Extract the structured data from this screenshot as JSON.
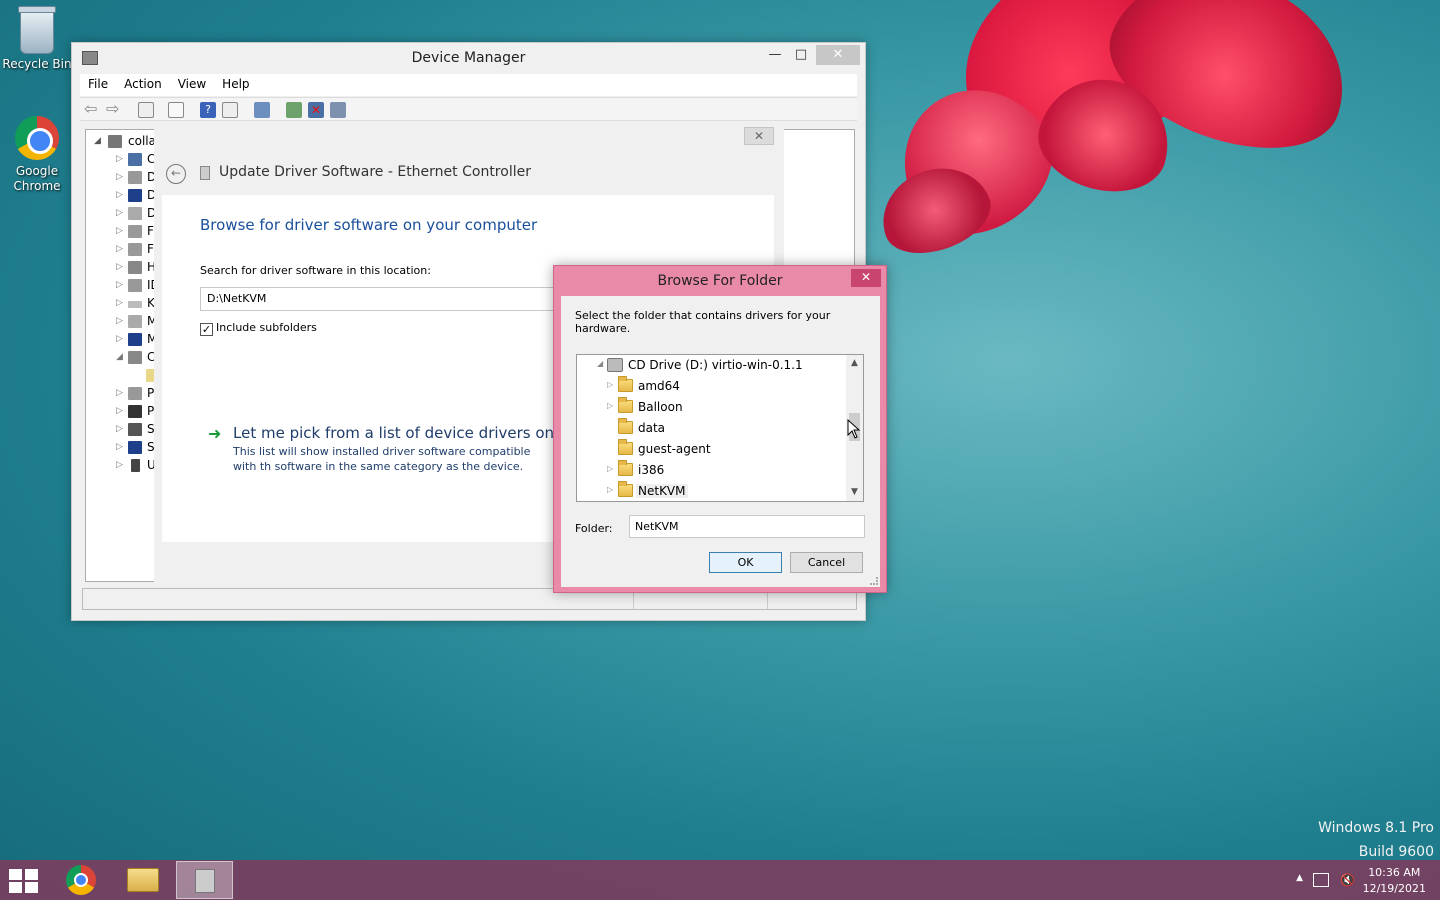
{
  "desktop": {
    "icons": [
      {
        "label": "Recycle Bin"
      },
      {
        "label": "Google Chrome"
      }
    ],
    "watermark_line1": "Windows 8.1 Pro",
    "watermark_line2": "Build 9600"
  },
  "device_manager": {
    "title": "Device Manager",
    "menu": [
      "File",
      "Action",
      "View",
      "Help"
    ],
    "tree": [
      {
        "label": "colla",
        "expanded": true
      },
      {
        "label": "C"
      },
      {
        "label": "D"
      },
      {
        "label": "D"
      },
      {
        "label": "D"
      },
      {
        "label": "F"
      },
      {
        "label": "F"
      },
      {
        "label": "H"
      },
      {
        "label": "ID"
      },
      {
        "label": "K"
      },
      {
        "label": "M"
      },
      {
        "label": "M"
      },
      {
        "label": "C",
        "expanded": true
      },
      {
        "label": ""
      },
      {
        "label": "P"
      },
      {
        "label": "P"
      },
      {
        "label": "S"
      },
      {
        "label": "S"
      },
      {
        "label": "U"
      }
    ]
  },
  "wizard": {
    "title": "Update Driver Software - Ethernet Controller",
    "heading": "Browse for driver software on your computer",
    "search_label": "Search for driver software in this location:",
    "search_value": "D:\\NetKVM",
    "include_subfolders": "Include subfolders",
    "pick_title": "Let me pick from a list of device drivers on my",
    "pick_desc": "This list will show installed driver software compatible with th software in the same category as the device."
  },
  "browse_folder": {
    "title": "Browse For Folder",
    "description": "Select the folder that contains drivers for your hardware.",
    "tree": [
      {
        "label": "CD Drive (D:) virtio-win-0.1.1",
        "level": 0,
        "expander": "◢",
        "type": "cd"
      },
      {
        "label": "amd64",
        "level": 1,
        "expander": "▷",
        "type": "folder"
      },
      {
        "label": "Balloon",
        "level": 1,
        "expander": "▷",
        "type": "folder"
      },
      {
        "label": "data",
        "level": 1,
        "expander": "",
        "type": "folder"
      },
      {
        "label": "guest-agent",
        "level": 1,
        "expander": "",
        "type": "folder"
      },
      {
        "label": "i386",
        "level": 1,
        "expander": "▷",
        "type": "folder"
      },
      {
        "label": "NetKVM",
        "level": 1,
        "expander": "▷",
        "type": "folder",
        "selected": true
      }
    ],
    "folder_label": "Folder:",
    "folder_value": "NetKVM",
    "ok": "OK",
    "cancel": "Cancel"
  },
  "taskbar": {
    "time": "10:36 AM",
    "date": "12/19/2021"
  }
}
